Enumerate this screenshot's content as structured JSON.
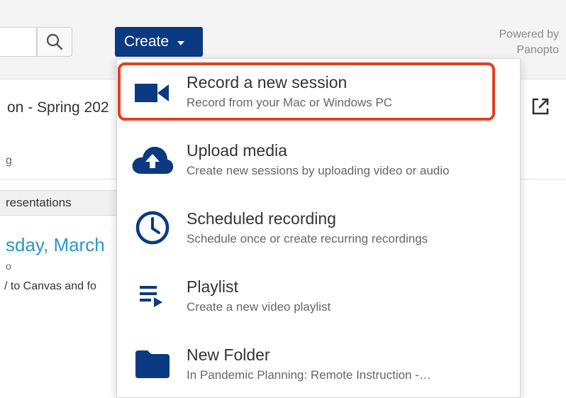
{
  "header": {
    "create_label": "Create",
    "powered_by_line1": "Powered by",
    "powered_by_line2": "Panopto"
  },
  "background": {
    "folder_title": "on - Spring 202",
    "folder_sub": "g",
    "tab_label": "resentations",
    "date_heading": "sday, March",
    "small_text": "o",
    "desc_line": "/ to Canvas and fo"
  },
  "menu": {
    "items": [
      {
        "icon": "video-camera-icon",
        "title": "Record a new session",
        "desc": "Record from your Mac or Windows PC"
      },
      {
        "icon": "cloud-upload-icon",
        "title": "Upload media",
        "desc": "Create new sessions by uploading video or audio"
      },
      {
        "icon": "clock-icon",
        "title": "Scheduled recording",
        "desc": "Schedule once or create recurring recordings"
      },
      {
        "icon": "playlist-icon",
        "title": "Playlist",
        "desc": "Create a new video playlist"
      },
      {
        "icon": "folder-icon",
        "title": "New Folder",
        "desc": "In Pandemic Planning: Remote Instruction -…"
      }
    ]
  },
  "colors": {
    "brand": "#0b3a82",
    "highlight": "#e2401f",
    "link": "#2a98c6"
  }
}
